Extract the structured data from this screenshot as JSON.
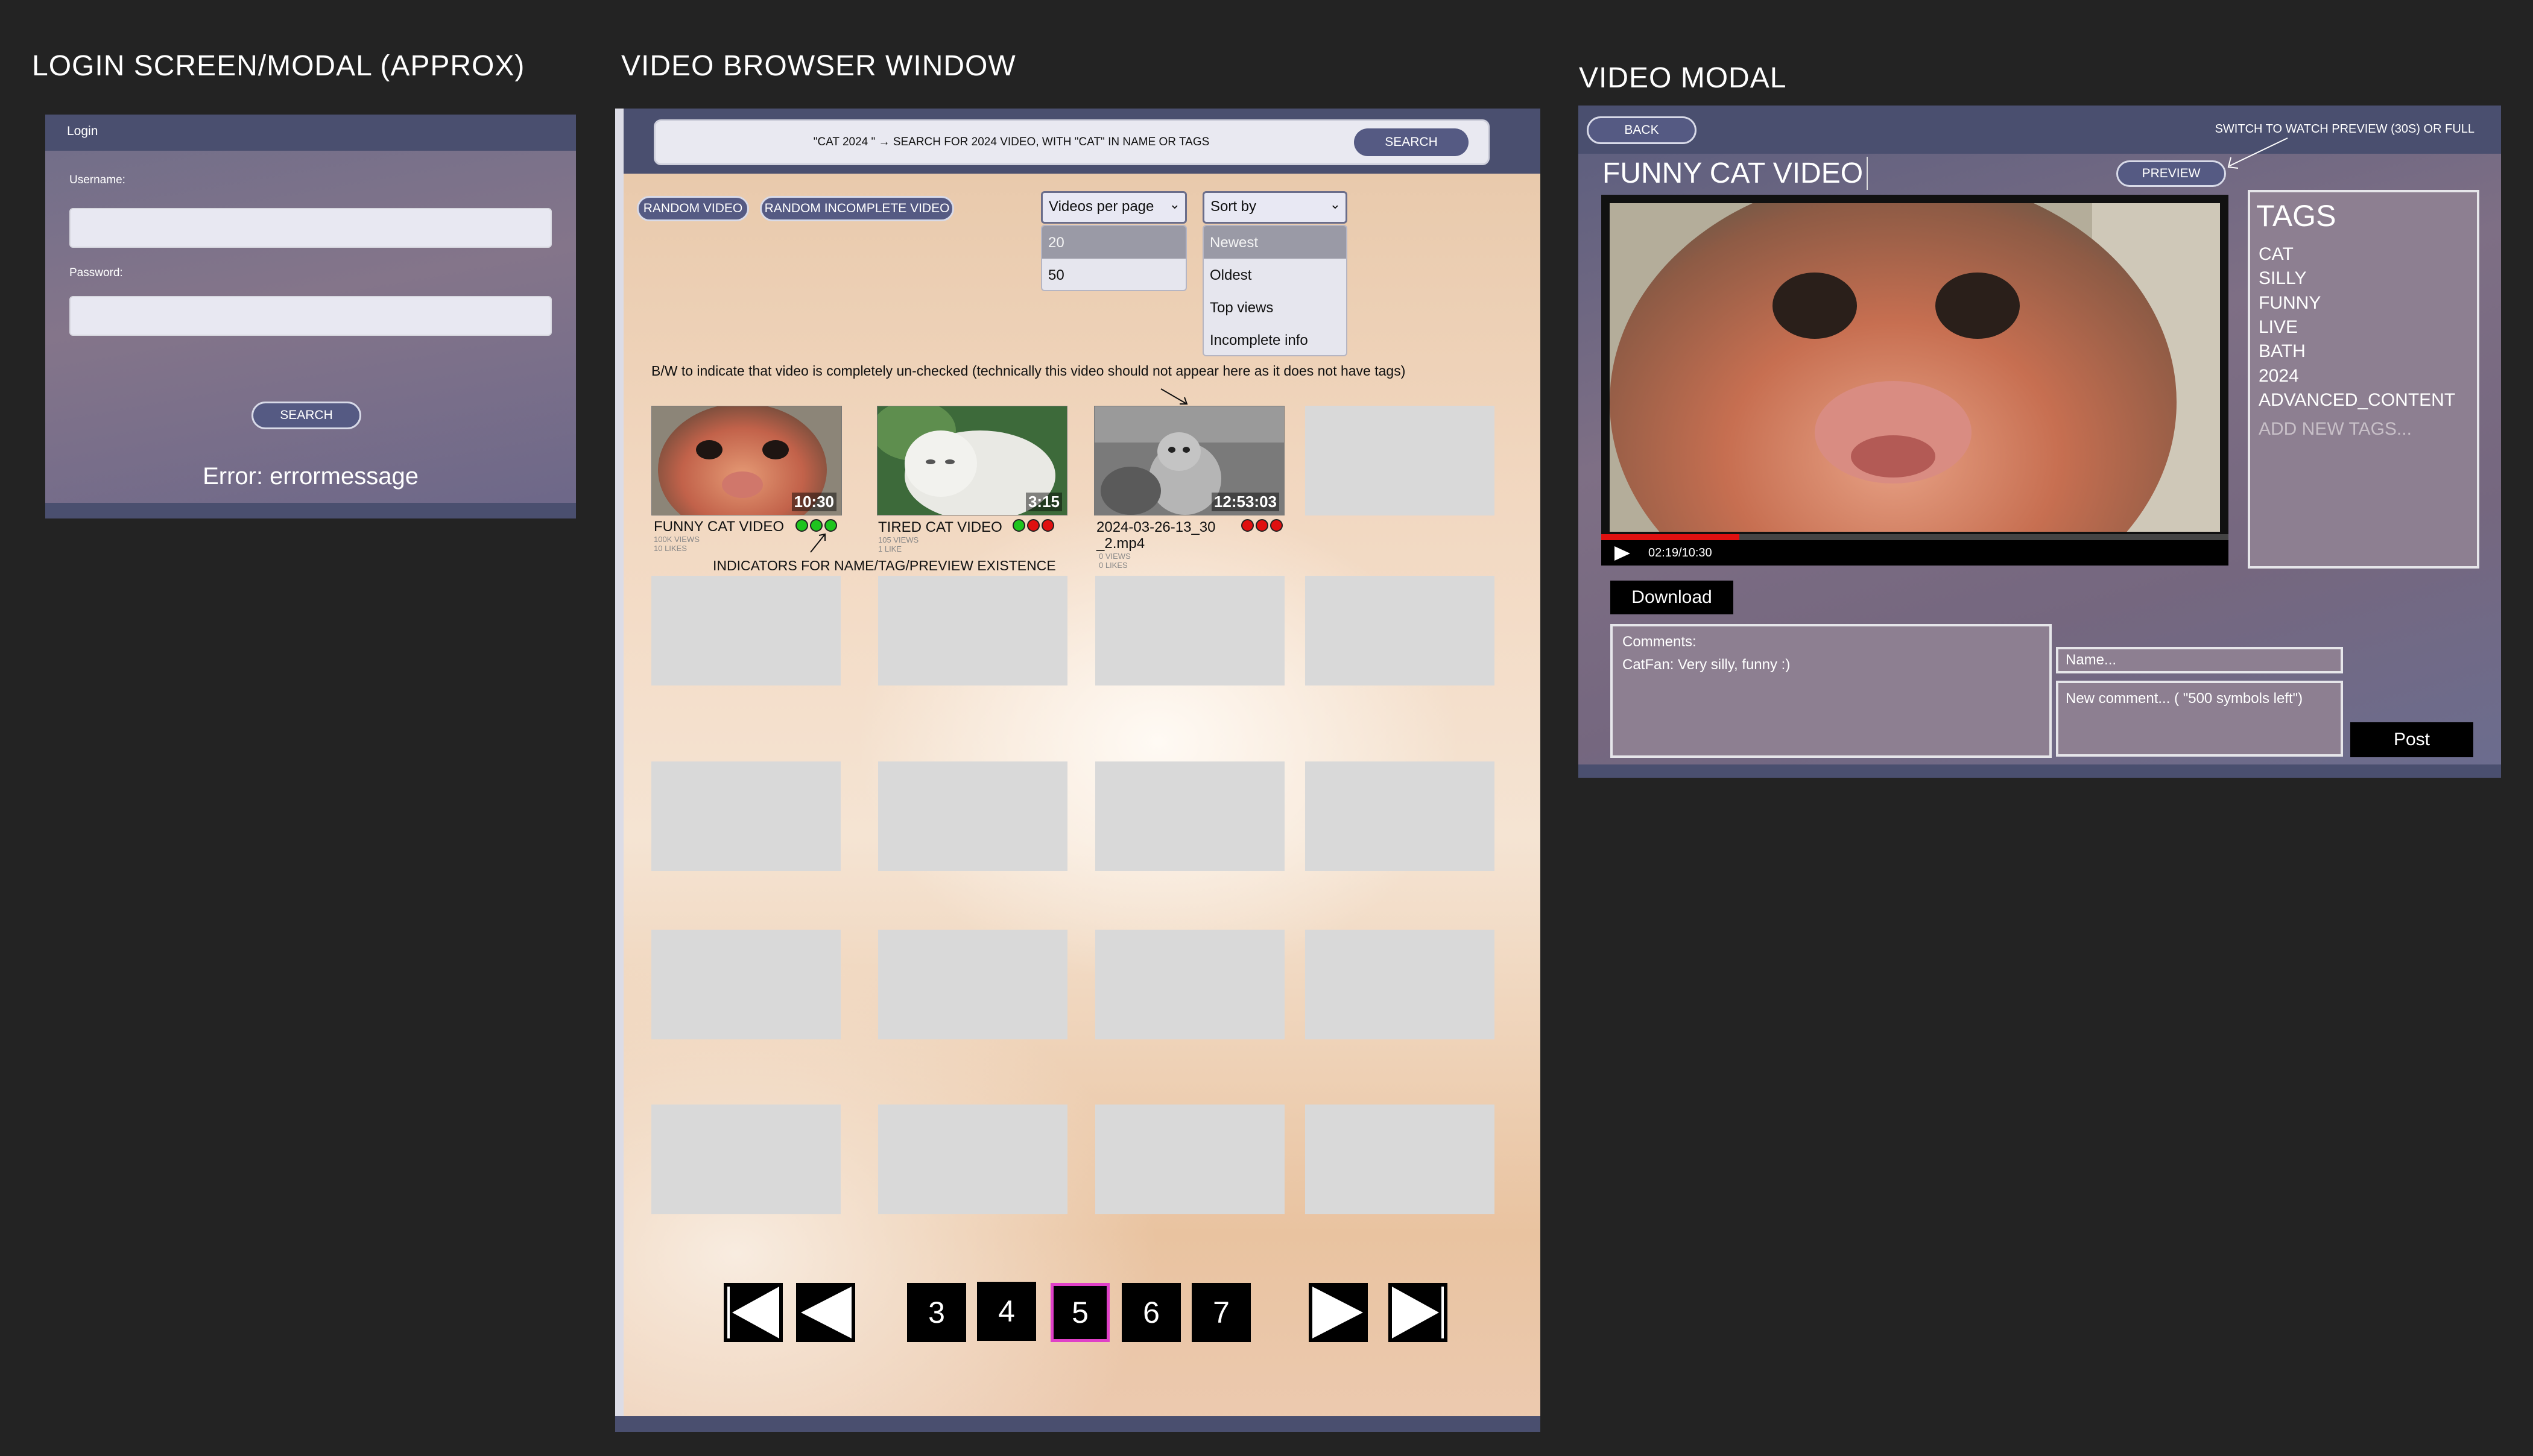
{
  "sections": {
    "login": "LOGIN SCREEN/MODAL (APPROX)",
    "browser": "VIDEO BROWSER WINDOW",
    "modal": "VIDEO MODAL"
  },
  "login": {
    "header": "Login",
    "username_label": "Username:",
    "password_label": "Password:",
    "username_value": "",
    "password_value": "",
    "error": "Error: errormessage",
    "button": "SEARCH"
  },
  "browser": {
    "search_text": "\"CAT 2024 \" → SEARCH FOR 2024 VIDEO, WITH \"CAT\" IN NAME OR TAGS",
    "search_button": "SEARCH",
    "random_button": "RANDOM VIDEO",
    "random_incomplete_button": "RANDOM INCOMPLETE VIDEO",
    "per_page": {
      "label": "Videos per page",
      "options": [
        "20",
        "50"
      ],
      "selected": "20"
    },
    "sort": {
      "label": "Sort by",
      "options": [
        "Newest",
        "Oldest",
        "Top views",
        "Incomplete info"
      ],
      "selected": "Newest"
    },
    "note_bw": "B/W to indicate that video is completely un-checked (technically this video should not appear here as it does not have tags)",
    "note_indicators": "INDICATORS FOR NAME/TAG/PREVIEW EXISTENCE",
    "videos": [
      {
        "title": "FUNNY CAT VIDEO",
        "duration": "10:30",
        "views": "100K VIEWS",
        "likes": "10 LIKES",
        "indicators": [
          "#1ec41e",
          "#1ec41e",
          "#1ec41e"
        ]
      },
      {
        "title": "TIRED CAT VIDEO",
        "duration": "3:15",
        "views": "105 VIEWS",
        "likes": "1 LIKE",
        "indicators": [
          "#1ec41e",
          "#e01010",
          "#e01010"
        ]
      },
      {
        "title": "2024-03-26-13_30",
        "title2": "_2.mp4",
        "duration": "12:53:03",
        "views": "0 VIEWS",
        "likes": "0 LIKES",
        "indicators": [
          "#e01010",
          "#e01010",
          "#e01010"
        ]
      }
    ],
    "pages": [
      "3",
      "4",
      "5",
      "6",
      "7"
    ],
    "current_page": "5",
    "colors": {
      "current_page_border": "#e040c8"
    }
  },
  "modal": {
    "back": "BACK",
    "switch_note": "SWITCH TO WATCH PREVIEW (30S) OR FULL",
    "title": "FUNNY CAT VIDEO",
    "preview_button": "PREVIEW",
    "time": "02:19/10:30",
    "progress": 0.22,
    "tags_header": "TAGS",
    "tags": [
      "CAT",
      "SILLY",
      "FUNNY",
      "LIVE",
      "BATH",
      "2024",
      "ADVANCED_CONTENT"
    ],
    "add_tags_placeholder": "ADD NEW TAGS...",
    "download": "Download",
    "comments_label": "Comments:",
    "comments": [
      "CatFan: Very silly, funny :)"
    ],
    "name_placeholder": "Name...",
    "comment_placeholder": "New comment... ( \"500 symbols left\")",
    "post": "Post",
    "colors": {
      "progress": "#e01010"
    }
  }
}
